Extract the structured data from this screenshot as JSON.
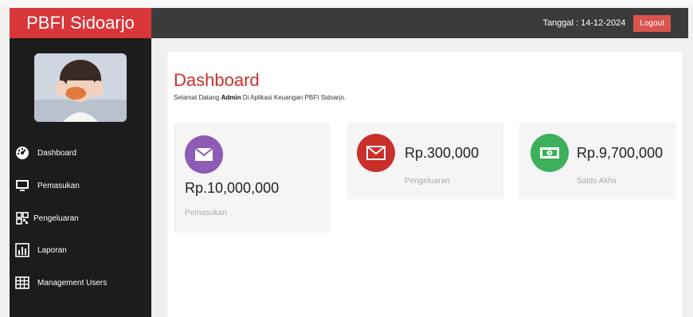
{
  "app": {
    "title": "PBFI Sidoarjo"
  },
  "header": {
    "date_label": "Tanggal : 14-12-2024",
    "logout_label": "Logout"
  },
  "sidebar": {
    "items": [
      {
        "label": "Dashboard",
        "icon": "tachometer-icon"
      },
      {
        "label": "Pemasukan",
        "icon": "monitor-icon"
      },
      {
        "label": "Pengeluaran",
        "icon": "qrcode-icon"
      },
      {
        "label": "Laporan",
        "icon": "bar-chart-icon"
      },
      {
        "label": "Management Users",
        "icon": "table-icon"
      }
    ]
  },
  "main": {
    "title": "Dashboard",
    "welcome_pre": "Selamat Datang",
    "welcome_user": "Admin",
    "welcome_post": "Di Aplikasi Keuangan PBFI Sidoarjo."
  },
  "cards": [
    {
      "amount": "Rp.10,000,000",
      "caption": "Pemasukan",
      "icon": "envelope-icon",
      "color": "#8e5bb5"
    },
    {
      "amount": "Rp.300,000",
      "caption": "Pengeluaran",
      "icon": "envelope-icon",
      "color": "#c9302c"
    },
    {
      "amount": "Rp.9,700,000",
      "caption": "Saldo Akhir",
      "icon": "money-icon",
      "color": "#3cb05a"
    }
  ],
  "colors": {
    "brand": "#d9363a",
    "topbar": "#3b3b3b",
    "sidebar": "#1c1c1c",
    "title": "#c9302c"
  }
}
